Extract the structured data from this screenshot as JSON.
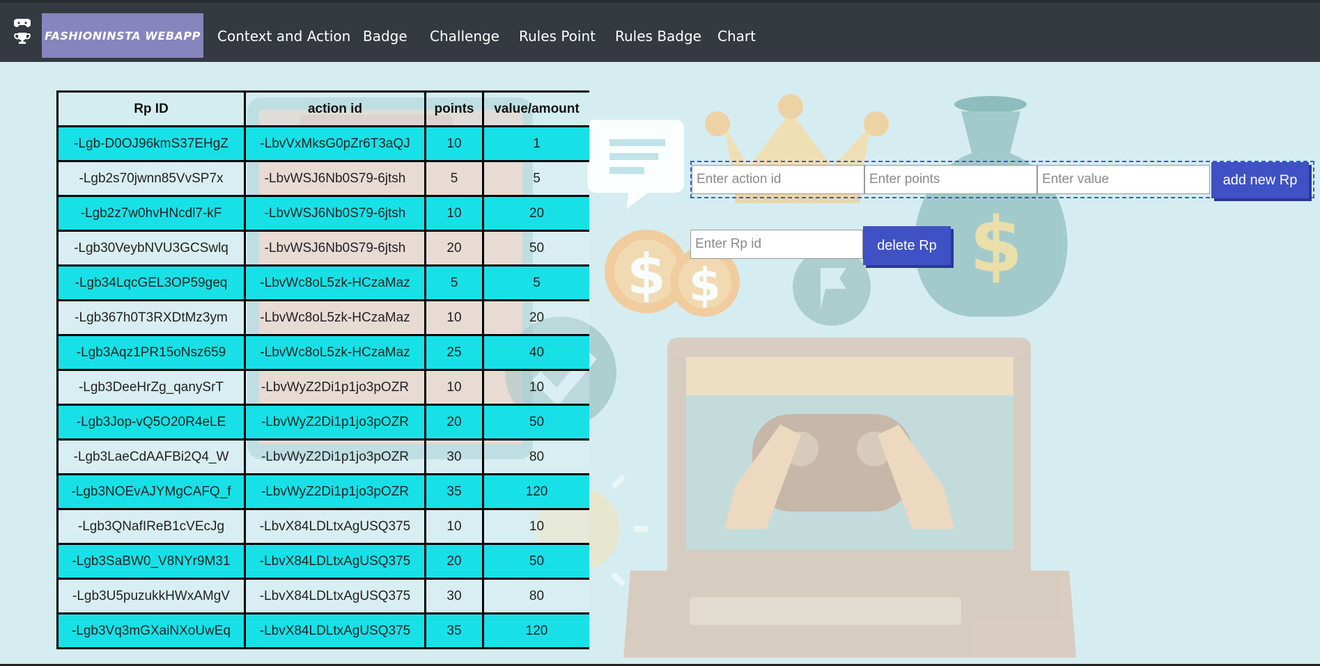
{
  "navbar": {
    "brand": "FASHIONINSTA WEBAPP",
    "links": [
      "Context and Action",
      "Badge",
      "Challenge",
      "Rules Point",
      "Rules Badge",
      "Chart"
    ],
    "icons": [
      "gamepad-icon",
      "trophy-icon"
    ]
  },
  "table": {
    "headers": [
      "Rp ID",
      "action id",
      "points",
      "value/amount"
    ],
    "rows": [
      [
        "-Lgb-D0OJ96kmS37EHgZ",
        "-LbvVxMksG0pZr6T3aQJ",
        "10",
        "1"
      ],
      [
        "-Lgb2s70jwnn85VvSP7x",
        "-LbvWSJ6Nb0S79-6jtsh",
        "5",
        "5"
      ],
      [
        "-Lgb2z7w0hvHNcdl7-kF",
        "-LbvWSJ6Nb0S79-6jtsh",
        "10",
        "20"
      ],
      [
        "-Lgb30VeybNVU3GCSwlq",
        "-LbvWSJ6Nb0S79-6jtsh",
        "20",
        "50"
      ],
      [
        "-Lgb34LqcGEL3OP59geq",
        "-LbvWc8oL5zk-HCzaMaz",
        "5",
        "5"
      ],
      [
        "-Lgb367h0T3RXDtMz3ym",
        "-LbvWc8oL5zk-HCzaMaz",
        "10",
        "20"
      ],
      [
        "-Lgb3Aqz1PR15oNsz659",
        "-LbvWc8oL5zk-HCzaMaz",
        "25",
        "40"
      ],
      [
        "-Lgb3DeeHrZg_qanySrT",
        "-LbvWyZ2Di1p1jo3pOZR",
        "10",
        "10"
      ],
      [
        "-Lgb3Jop-vQ5O20R4eLE",
        "-LbvWyZ2Di1p1jo3pOZR",
        "20",
        "50"
      ],
      [
        "-Lgb3LaeCdAAFBi2Q4_W",
        "-LbvWyZ2Di1p1jo3pOZR",
        "30",
        "80"
      ],
      [
        "-Lgb3NOEvAJYMgCAFQ_f",
        "-LbvWyZ2Di1p1jo3pOZR",
        "35",
        "120"
      ],
      [
        "-Lgb3QNafIReB1cVEcJg",
        "-LbvX84LDLtxAgUSQ375",
        "10",
        "10"
      ],
      [
        "-Lgb3SaBW0_V8NYr9M31",
        "-LbvX84LDLtxAgUSQ375",
        "20",
        "50"
      ],
      [
        "-Lgb3U5puzukkHWxAMgV",
        "-LbvX84LDLtxAgUSQ375",
        "30",
        "80"
      ],
      [
        "-Lgb3Vq3mGXaiNXoUwEq",
        "-LbvX84LDLtxAgUSQ375",
        "35",
        "120"
      ]
    ]
  },
  "add_form": {
    "action_placeholder": "Enter action id",
    "points_placeholder": "Enter points",
    "value_placeholder": "Enter value",
    "button": "add new Rp"
  },
  "delete_form": {
    "rp_placeholder": "Enter Rp id",
    "button": "delete Rp"
  },
  "colors": {
    "navbar": "#343a40",
    "brand_bg": "#8785bd",
    "row_cyan": "#17e1e7",
    "page_bg": "#d5edf1",
    "button": "#3f51c4"
  }
}
